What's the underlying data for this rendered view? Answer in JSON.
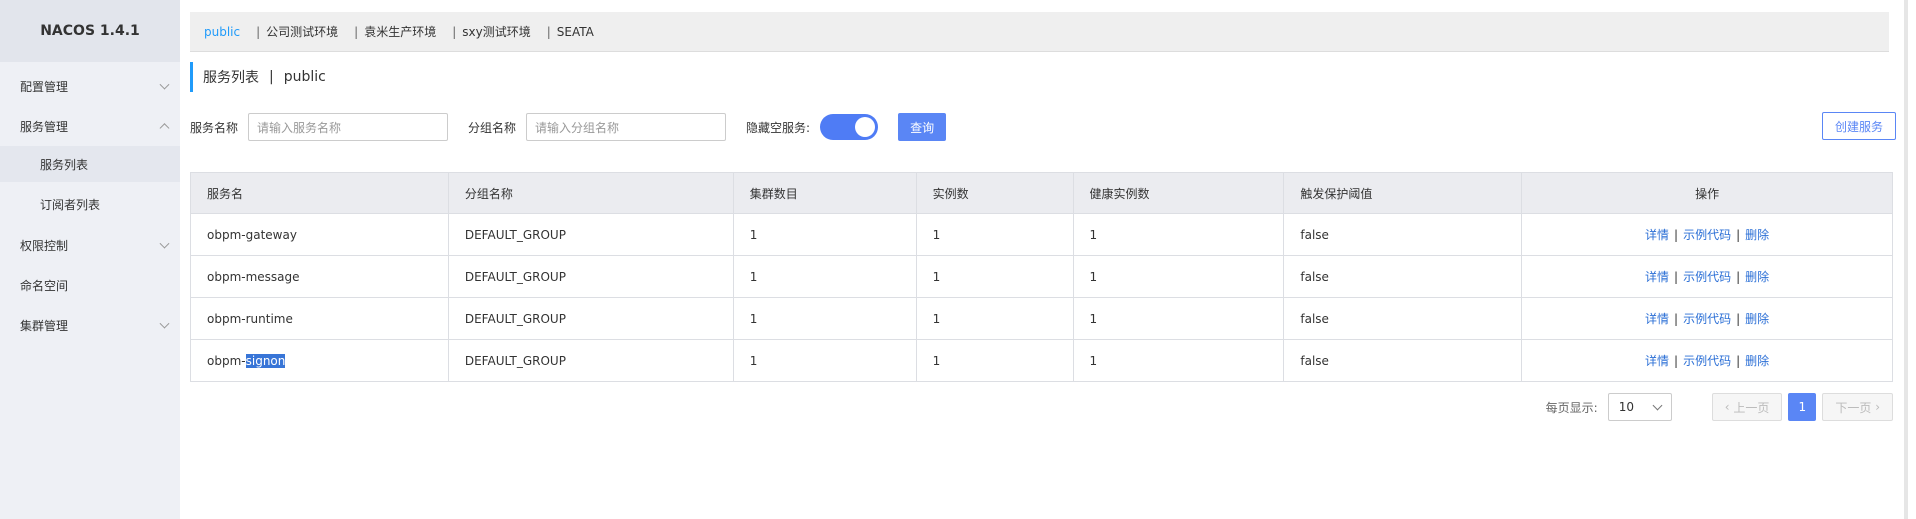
{
  "app": {
    "logo": "NACOS 1.4.1"
  },
  "sidebar": {
    "items": [
      {
        "label": "配置管理"
      },
      {
        "label": "服务管理"
      },
      {
        "label": "服务列表"
      },
      {
        "label": "订阅者列表"
      },
      {
        "label": "权限控制"
      },
      {
        "label": "命名空间"
      },
      {
        "label": "集群管理"
      }
    ]
  },
  "namespaces": {
    "items": [
      {
        "label": "public"
      },
      {
        "label": "公司测试环境"
      },
      {
        "label": "袁米生产环境"
      },
      {
        "label": "sxy测试环境"
      },
      {
        "label": "SEATA"
      }
    ],
    "separator": "|"
  },
  "title": {
    "main": "服务列表",
    "separator": "|",
    "namespace": "public"
  },
  "filters": {
    "service_label": "服务名称",
    "service_placeholder": "请输入服务名称",
    "group_label": "分组名称",
    "group_placeholder": "请输入分组名称",
    "hide_empty_label": "隐藏空服务:",
    "query_button": "查询",
    "create_button": "创建服务"
  },
  "table": {
    "headers": [
      "服务名",
      "分组名称",
      "集群数目",
      "实例数",
      "健康实例数",
      "触发保护阈值",
      "操作"
    ],
    "rows": [
      {
        "name": "obpm-gateway",
        "group": "DEFAULT_GROUP",
        "clusters": "1",
        "instances": "1",
        "healthy": "1",
        "threshold": "false"
      },
      {
        "name": "obpm-message",
        "group": "DEFAULT_GROUP",
        "clusters": "1",
        "instances": "1",
        "healthy": "1",
        "threshold": "false"
      },
      {
        "name": "obpm-runtime",
        "group": "DEFAULT_GROUP",
        "clusters": "1",
        "instances": "1",
        "healthy": "1",
        "threshold": "false"
      },
      {
        "name_prefix": "obpm-",
        "name_selected": "signon",
        "group": "DEFAULT_GROUP",
        "clusters": "1",
        "instances": "1",
        "healthy": "1",
        "threshold": "false"
      }
    ],
    "ops": {
      "detail": "详情",
      "sample": "示例代码",
      "delete": "删除",
      "sep": "|"
    }
  },
  "pager": {
    "page_size_label": "每页显示:",
    "page_size": "10",
    "prev": "上一页",
    "next": "下一页",
    "current": "1"
  },
  "colors": {
    "accent": "#5a86f5",
    "link": "#2b6fd6",
    "active_ns": "#209bfa"
  }
}
